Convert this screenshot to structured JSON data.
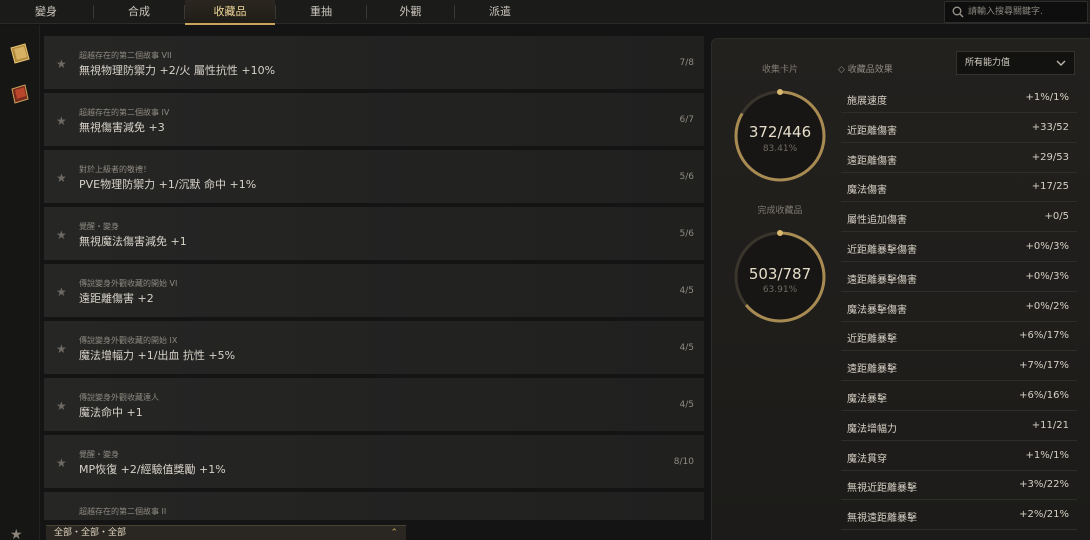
{
  "tabs": [
    {
      "label": "變身"
    },
    {
      "label": "合成"
    },
    {
      "label": "收藏品"
    },
    {
      "label": "重抽"
    },
    {
      "label": "外觀"
    },
    {
      "label": "派遣"
    }
  ],
  "active_tab": "收藏品",
  "search": {
    "placeholder": "請輸入搜尋關鍵字."
  },
  "rail": {
    "icons": [
      "book-gold-icon",
      "book-red-icon",
      "star-icon"
    ]
  },
  "collections": [
    {
      "sub": "超越存在的第二個故事 VII",
      "main": "無視物理防禦力 +2/火 屬性抗性 +10%",
      "count": "7/8"
    },
    {
      "sub": "超越存在的第二個故事 IV",
      "main": "無視傷害減免 +3",
      "count": "6/7"
    },
    {
      "sub": "對於上級者的敬禮！",
      "main": "PVE物理防禦力 +1/沉默 命中 +1%",
      "count": "5/6"
    },
    {
      "sub": "覺醒・變身",
      "main": "無視魔法傷害減免 +1",
      "count": "5/6"
    },
    {
      "sub": "傳說變身外觀收藏的開始 VI",
      "main": "遠距離傷害 +2",
      "count": "4/5"
    },
    {
      "sub": "傳說變身外觀收藏的開始 IX",
      "main": "魔法增幅力 +1/出血 抗性 +5%",
      "count": "4/5"
    },
    {
      "sub": "傳說變身外觀收藏達人",
      "main": "魔法命中 +1",
      "count": "4/5"
    },
    {
      "sub": "覺醒・變身",
      "main": "MP恢復 +2/經驗值獎勵 +1%",
      "count": "8/10"
    },
    {
      "sub": "超越存在的第二個故事 II",
      "main": "",
      "count": ""
    }
  ],
  "filter": {
    "label": "全部・全部・全部"
  },
  "gauges": {
    "cards": {
      "title": "收集卡片",
      "value": "372/446",
      "pct": "83.41%",
      "fraction": 0.8341
    },
    "completed": {
      "title": "完成收藏品",
      "value": "503/787",
      "pct": "63.91%",
      "fraction": 0.6391
    }
  },
  "effects": {
    "title": "收藏品效果",
    "dropdown": "所有能力值",
    "stats": [
      {
        "name": "施展速度",
        "value": "+1%/1%"
      },
      {
        "name": "近距離傷害",
        "value": "+33/52"
      },
      {
        "name": "遠距離傷害",
        "value": "+29/53"
      },
      {
        "name": "魔法傷害",
        "value": "+17/25"
      },
      {
        "name": "屬性追加傷害",
        "value": "+0/5"
      },
      {
        "name": "近距離暴擊傷害",
        "value": "+0%/3%"
      },
      {
        "name": "遠距離暴擊傷害",
        "value": "+0%/3%"
      },
      {
        "name": "魔法暴擊傷害",
        "value": "+0%/2%"
      },
      {
        "name": "近距離暴擊",
        "value": "+6%/17%"
      },
      {
        "name": "遠距離暴擊",
        "value": "+7%/17%"
      },
      {
        "name": "魔法暴擊",
        "value": "+6%/16%"
      },
      {
        "name": "魔法增幅力",
        "value": "+11/21"
      },
      {
        "name": "魔法貫穿",
        "value": "+1%/1%"
      },
      {
        "name": "無視近距離暴擊",
        "value": "+3%/22%"
      },
      {
        "name": "無視遠距離暴擊",
        "value": "+2%/21%"
      }
    ]
  },
  "colors": {
    "accent": "#c9a45a",
    "background": "#141414"
  }
}
